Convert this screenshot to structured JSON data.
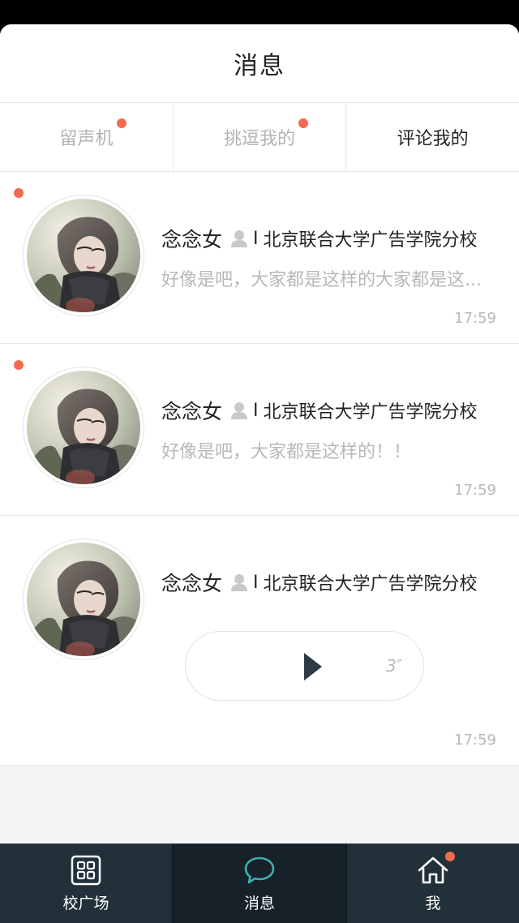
{
  "header": {
    "title": "消息"
  },
  "tabs": [
    {
      "label": "留声机",
      "has_dot": true,
      "active": false
    },
    {
      "label": "挑逗我的",
      "has_dot": true,
      "active": false
    },
    {
      "label": "评论我的",
      "has_dot": false,
      "active": true
    }
  ],
  "messages": [
    {
      "unread": true,
      "name": "念念女",
      "separator": "I",
      "school": "北京联合大学广告学院分校",
      "preview": "好像是吧，大家都是这样的大家都是这...",
      "time": "17:59"
    },
    {
      "unread": true,
      "name": "念念女",
      "separator": "I",
      "school": "北京联合大学广告学院分校",
      "preview": "好像是吧，大家都是这样的！！",
      "time": "17:59"
    },
    {
      "unread": false,
      "name": "念念女",
      "separator": "I",
      "school": "北京联合大学广告学院分校",
      "voice_duration": "3″",
      "time": "17:59"
    }
  ],
  "bottom_nav": [
    {
      "label": "校广场",
      "icon": "grid-icon",
      "active": false
    },
    {
      "label": "消息",
      "icon": "chat-bubble-icon",
      "active": true
    },
    {
      "label": "我",
      "icon": "home-icon",
      "active": false,
      "badge": true
    }
  ],
  "colors": {
    "accent_dot": "#f36a4e",
    "nav_bg": "#213039",
    "nav_active_bg": "#16212a",
    "chat_icon_teal": "#3fb0b0"
  }
}
